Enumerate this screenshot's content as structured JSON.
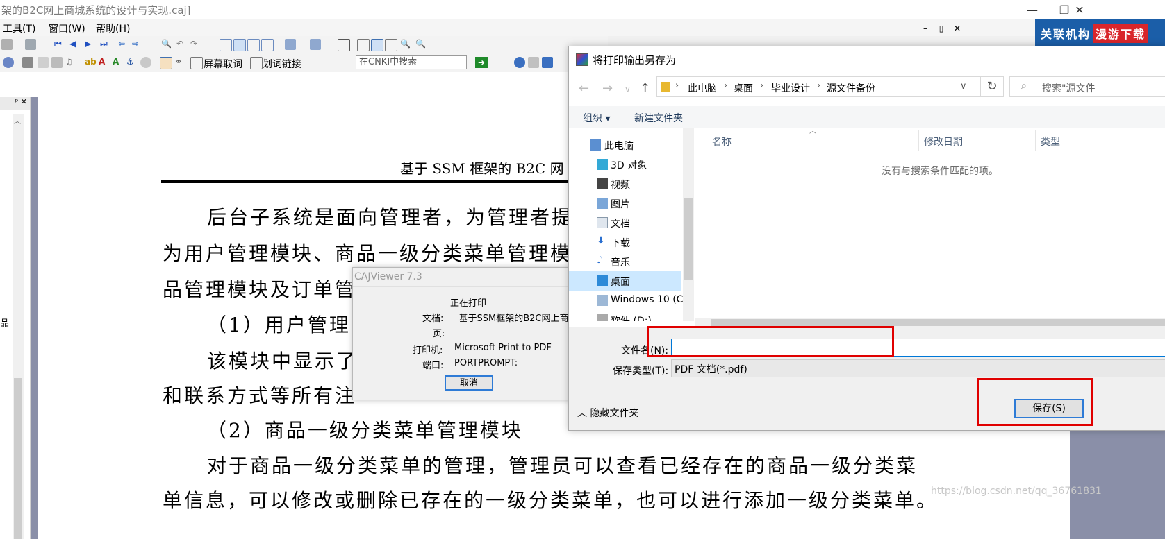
{
  "app": {
    "title": "架的B2C网上商城系统的设计与实现.caj]",
    "window_controls": {
      "minimize": "—",
      "restore": "❐",
      "close": "✕"
    }
  },
  "menubar": {
    "items": [
      "工具(T)",
      "窗口(W)",
      "帮助(H)"
    ],
    "mdi_controls": [
      "–",
      "▯",
      "✕"
    ]
  },
  "banner": {
    "text": "关联机构",
    "highlight": "漫游下载"
  },
  "toolbar": {
    "screen_capture": "屏幕取词",
    "word_link": "划词链接",
    "cnki_search_placeholder": "在CNKI中搜索"
  },
  "left_panel": {
    "pin_close": "ᵖ ✕",
    "side_char": "品"
  },
  "document": {
    "header": "基于 SSM 框架的 B2C 网",
    "lines": [
      "后台子系统是面向管理者，为管理者提",
      "为用户管理模块、商品一级分类菜单管理模",
      "品管理模块及订单管",
      "（1）用户管理",
      "该模块中显示了",
      "和联系方式等所有注",
      "（2）商品一级分类菜单管理模块",
      "对于商品一级分类菜单的管理，管理员可以查看已经存在的商品一级分类菜",
      "单信息，可以修改或删除已存在的一级分类菜单，也可以进行添加一级分类菜单。"
    ],
    "watermark": "https://blog.csdn.net/qq_36761831"
  },
  "print_dialog": {
    "title": "CAJViewer 7.3",
    "status": "正在打印",
    "doc_label": "文档:",
    "doc_value": "_基于SSM框架的B2C网上商",
    "page_label": "页:",
    "printer_label": "打印机:",
    "printer_value": "Microsoft Print to PDF",
    "port_label": "端口:",
    "port_value": "PORTPROMPT:",
    "cancel": "取消"
  },
  "save_dialog": {
    "title": "将打印输出另存为",
    "breadcrumbs": [
      "此电脑",
      "桌面",
      "毕业设计",
      "源文件备份"
    ],
    "search_placeholder": "搜索\"源文件",
    "organize": "组织 ▾",
    "new_folder": "新建文件夹",
    "nav_items": [
      "此电脑",
      "3D 对象",
      "视频",
      "图片",
      "文档",
      "下载",
      "音乐",
      "桌面",
      "Windows 10 (C",
      "软件 (D:)"
    ],
    "selected_nav": "桌面",
    "columns": [
      "名称",
      "修改日期",
      "类型"
    ],
    "empty_message": "没有与搜索条件匹配的项。",
    "filename_label": "文件名(N):",
    "filename_value": "",
    "filetype_label": "保存类型(T):",
    "filetype_value": "PDF 文档(*.pdf)",
    "hide_folders": "隐藏文件夹",
    "save": "保存(S)"
  },
  "colors": {
    "banner": "#1b5ea8",
    "banner_highlight": "#d9262b",
    "highlight_box": "#e00000",
    "focus": "#0078d7",
    "nav_selected": "#cce8ff"
  }
}
